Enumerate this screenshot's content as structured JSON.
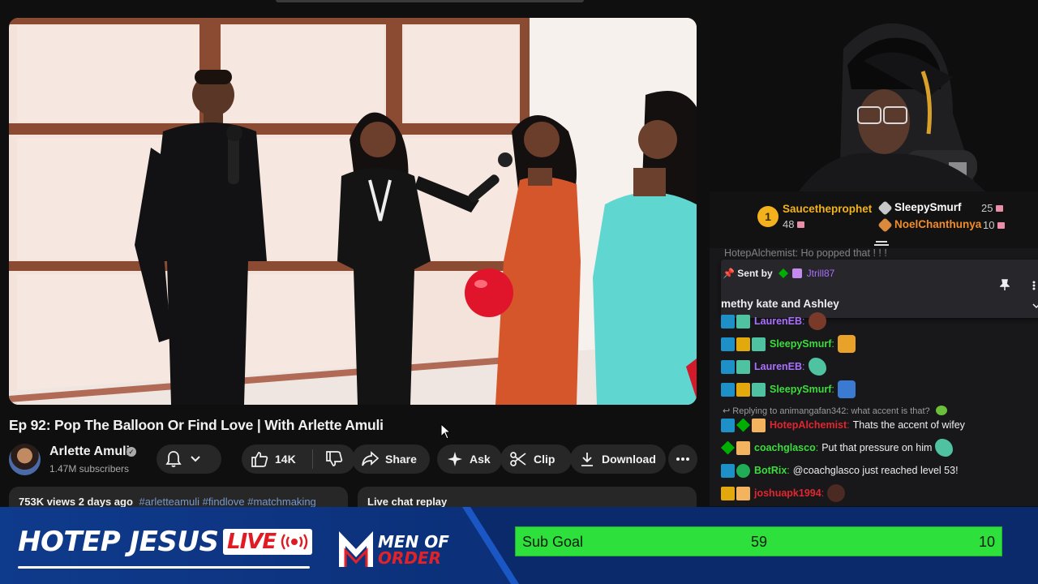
{
  "video": {
    "title": "Ep 92: Pop The Balloon Or Find Love | With Arlette Amuli"
  },
  "channel": {
    "name": "Arlette Amuli",
    "subscribers": "1.47M subscribers"
  },
  "actions": {
    "likes": "14K",
    "share": "Share",
    "ask": "Ask",
    "clip": "Clip",
    "download": "Download"
  },
  "description": {
    "stats": "753K views  2 days ago",
    "tags": "#arletteamuli #findlove #matchmaking"
  },
  "live_chat_replay": "Live chat replay",
  "leaderboard": {
    "first": {
      "rank": "1",
      "name": "Saucetheprophet",
      "count": "48"
    },
    "second": {
      "name": "SleepySmurf",
      "count": "25"
    },
    "third": {
      "name": "NoelChanthunya",
      "count": "10"
    }
  },
  "chat": {
    "partial_line": "HotepAlchemist: Ho popped that ! ! !",
    "pinned": {
      "sent_by_label": "Sent by",
      "sender": "Jtrill87",
      "message": "methy kate and Ashley"
    },
    "messages": [
      {
        "user": "LaurenEB",
        "text": "",
        "color": "#a970ff"
      },
      {
        "user": "SleepySmurf",
        "text": "",
        "color": "#3cdc3c"
      },
      {
        "user": "LaurenEB",
        "text": "",
        "color": "#a970ff"
      },
      {
        "user": "SleepySmurf",
        "text": "",
        "color": "#3cdc3c"
      },
      {
        "user": "HotepAlchemist",
        "text": "Thats the accent of wifey",
        "color": "#e0262e"
      },
      {
        "user": "coachglasco",
        "text": "Put that pressure on him",
        "color": "#3cdc3c"
      },
      {
        "user": "BotRix",
        "text": "@coachglasco just reached level 53!",
        "color": "#3cdc3c"
      },
      {
        "user": "joshuapk1994",
        "text": "",
        "color": "#e0262e"
      }
    ],
    "reply_text": "Replying to animangafan342: what accent is that?"
  },
  "bottom_bar": {
    "brand": "HOTEP JESUS",
    "live": "LIVE",
    "partner_line1": "MEN OF",
    "partner_line2": "ORDER",
    "goal_label": "Sub Goal",
    "goal_current": "59",
    "goal_target": "10"
  },
  "colors": {
    "youtube_bg": "#0f0f0f",
    "pill_bg": "#272727",
    "chat_bg": "#18181b",
    "bar_blue": "#0b2a6b",
    "goal_green": "#2ee03c",
    "live_red": "#e01b24"
  }
}
